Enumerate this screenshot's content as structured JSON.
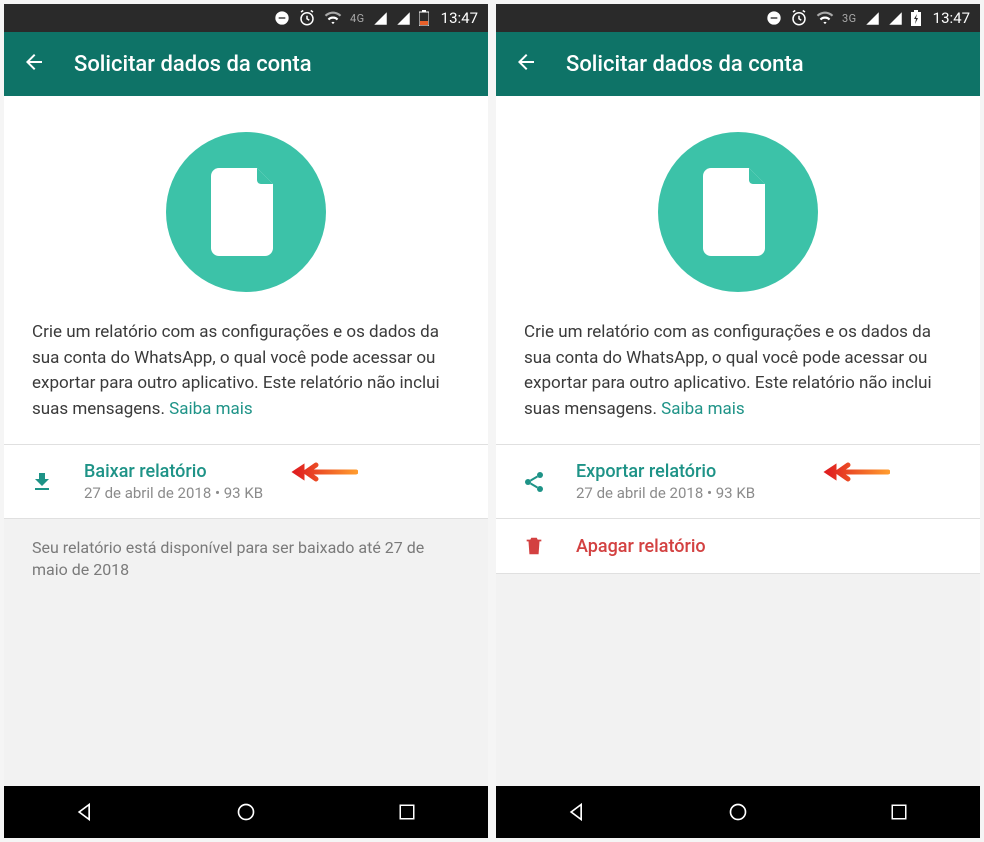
{
  "statusBar": {
    "time": "13:47",
    "network_left": "4G",
    "network_right": "3G"
  },
  "header": {
    "title": "Solicitar dados da conta"
  },
  "body": {
    "description": "Crie um relatório com as configurações e os dados da sua conta do WhatsApp, o qual você pode acessar ou exportar para outro aplicativo. Este relatório não inclui suas mensagens.",
    "learn_more": "Saiba mais"
  },
  "left": {
    "download": {
      "title": "Baixar relatório",
      "subtitle": "27 de abril de 2018 • 93 KB"
    },
    "footer": "Seu relatório está disponível para ser baixado até 27 de maio de 2018"
  },
  "right": {
    "export": {
      "title": "Exportar relatório",
      "subtitle": "27 de abril de 2018 • 93 KB"
    },
    "delete": {
      "title": "Apagar relatório"
    }
  }
}
